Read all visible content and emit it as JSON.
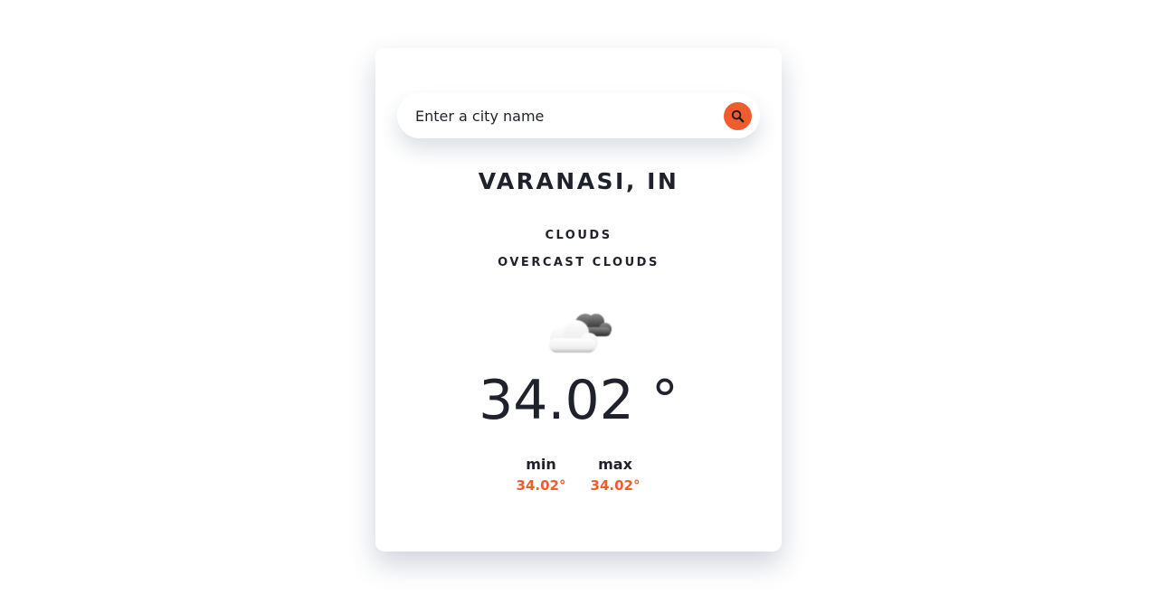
{
  "search": {
    "placeholder": "Enter a city name",
    "value": ""
  },
  "location": {
    "city": "VARANASI, IN"
  },
  "weather": {
    "main": "CLOUDS",
    "description": "OVERCAST CLOUDS",
    "icon": "overcast-clouds-icon",
    "temperature": "34.02 °",
    "min_label": "min",
    "min_value": "34.02°",
    "max_label": "max",
    "max_value": "34.02°"
  },
  "colors": {
    "accent": "#f05c2e",
    "text": "#1f222b",
    "background": "#ffffff"
  }
}
